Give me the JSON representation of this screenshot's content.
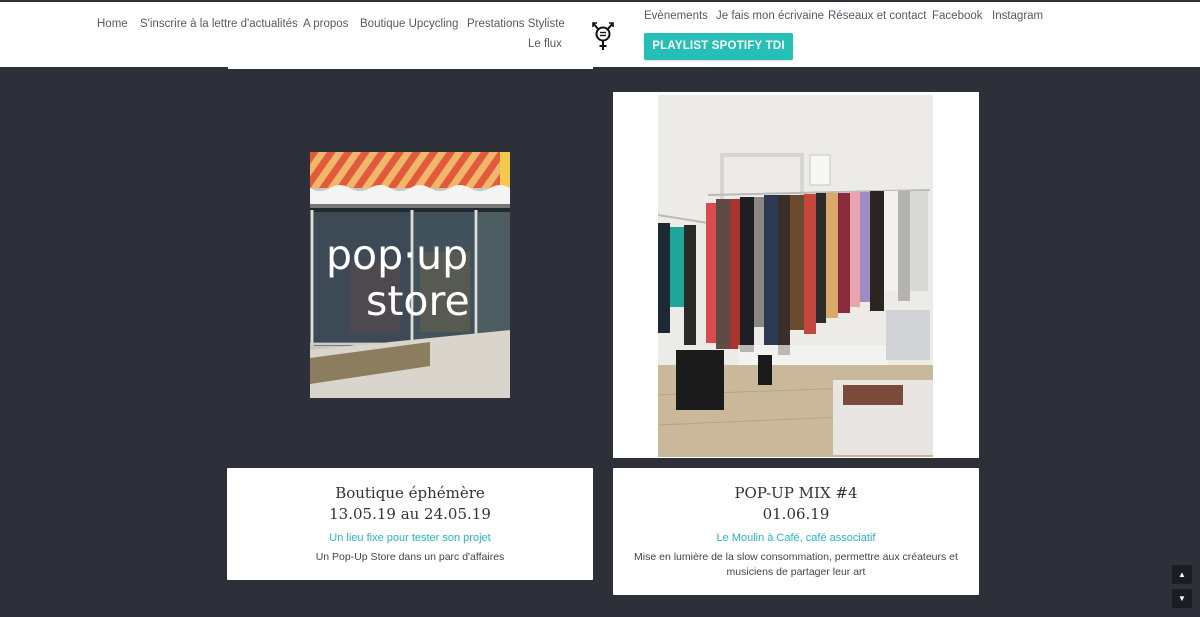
{
  "nav_left": [
    "Home",
    "S'inscrire à la lettre d'actualités",
    "A propos",
    "Boutique Upcycling",
    "Prestations Styliste",
    "Le flux"
  ],
  "nav_right": [
    "Evènements",
    "Je fais mon écrivaine",
    "Réseaux et contact",
    "Facebook",
    "Instagram"
  ],
  "spotify_button": "PLAYLIST SPOTIFY TDI",
  "cards": [
    {
      "title": "Boutique éphémère",
      "date": "13.05.19 au 24.05.19",
      "subtitle": "Un lieu fixe pour tester son projet",
      "description": "Un Pop-Up Store dans un parc d'affaires",
      "image_text": [
        "pop·up",
        "store"
      ]
    },
    {
      "title": "POP-UP MIX #4",
      "date": "01.06.19",
      "subtitle": "Le Moulin à Café, café associatif",
      "description": "Mise en lumière de la slow consommation, permettre aux créateurs et musiciens de partager leur art"
    }
  ],
  "colors": {
    "accent": "#26bfb5",
    "link": "#26b5c9",
    "background": "#2d3039"
  },
  "icons": {
    "logo": "transgender-symbol-icon",
    "scroll_up": "arrow-up-icon",
    "scroll_down": "arrow-down-icon"
  }
}
